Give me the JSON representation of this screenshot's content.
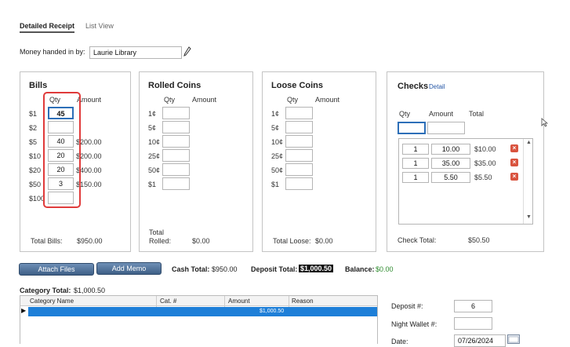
{
  "tabs": [
    {
      "label": "Detailed Receipt"
    },
    {
      "label": "List View"
    }
  ],
  "handed_in": {
    "label": "Money handed in by:",
    "value": "Laurie Library"
  },
  "bills": {
    "title": "Bills",
    "qty_header": "Qty",
    "amount_header": "Amount",
    "rows": [
      {
        "denom": "$1",
        "qty": "45",
        "amount": ""
      },
      {
        "denom": "$2",
        "qty": "",
        "amount": ""
      },
      {
        "denom": "$5",
        "qty": "40",
        "amount": "$200.00"
      },
      {
        "denom": "$10",
        "qty": "20",
        "amount": "$200.00"
      },
      {
        "denom": "$20",
        "qty": "20",
        "amount": "$400.00"
      },
      {
        "denom": "$50",
        "qty": "3",
        "amount": "$150.00"
      },
      {
        "denom": "$100",
        "qty": "",
        "amount": ""
      }
    ],
    "total_label": "Total Bills:",
    "total_value": "$950.00"
  },
  "rolled": {
    "title": "Rolled Coins",
    "qty_header": "Qty",
    "amount_header": "Amount",
    "rows": [
      {
        "denom": "1¢",
        "qty": ""
      },
      {
        "denom": "5¢",
        "qty": ""
      },
      {
        "denom": "10¢",
        "qty": ""
      },
      {
        "denom": "25¢",
        "qty": ""
      },
      {
        "denom": "50¢",
        "qty": ""
      },
      {
        "denom": "$1",
        "qty": ""
      }
    ],
    "total_label_1": "Total",
    "total_label_2": "Rolled:",
    "total_value": "$0.00"
  },
  "loose": {
    "title": "Loose Coins",
    "qty_header": "Qty",
    "amount_header": "Amount",
    "rows": [
      {
        "denom": "1¢",
        "qty": ""
      },
      {
        "denom": "5¢",
        "qty": ""
      },
      {
        "denom": "10¢",
        "qty": ""
      },
      {
        "denom": "25¢",
        "qty": ""
      },
      {
        "denom": "50¢",
        "qty": ""
      },
      {
        "denom": "$1",
        "qty": ""
      }
    ],
    "total_label": "Total Loose:",
    "total_value": "$0.00"
  },
  "checks": {
    "title": "Checks",
    "detail_link": "Detail",
    "qty_header": "Qty",
    "amount_header": "Amount",
    "total_header": "Total",
    "rows": [
      {
        "qty": "1",
        "amount": "10.00",
        "total": "$10.00"
      },
      {
        "qty": "1",
        "amount": "35.00",
        "total": "$35.00"
      },
      {
        "qty": "1",
        "amount": "5.50",
        "total": "$5.50"
      }
    ],
    "total_label": "Check Total:",
    "total_value": "$50.50"
  },
  "actions": {
    "attach_files": "Attach Files",
    "add_memo": "Add Memo"
  },
  "summary": {
    "cash_label": "Cash Total:",
    "cash_value": "$950.00",
    "deposit_label": "Deposit Total:",
    "deposit_value": "$1,000.50",
    "balance_label": "Balance:",
    "balance_value": "$0.00"
  },
  "category": {
    "total_label": "Category Total:",
    "total_value": "$1,000.50",
    "headers": [
      "Category Name",
      "Cat. #",
      "Amount",
      "Reason"
    ],
    "row_amount": "$1,000.50"
  },
  "deposit_form": {
    "deposit_label": "Deposit #:",
    "deposit_value": "6",
    "night_wallet_label": "Night Wallet #:",
    "night_wallet_value": "",
    "date_label": "Date:",
    "date_value": "07/26/2024"
  },
  "colors": {
    "highlight": "#e03b3b",
    "balance": "#2e8b2e",
    "accent": "#1e7fd8"
  }
}
